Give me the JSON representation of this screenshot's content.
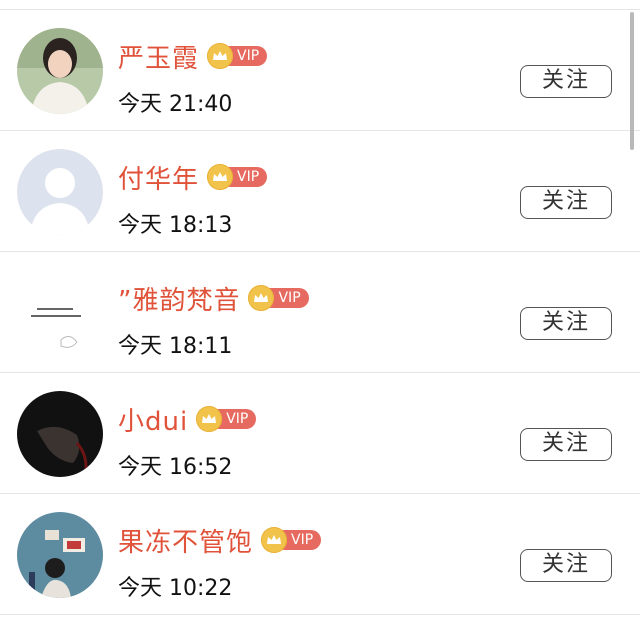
{
  "follow_label": "关注",
  "vip_label": "VIP",
  "users": [
    {
      "name": "严玉霞",
      "time": "今天 21:40"
    },
    {
      "name": "付华年",
      "time": "今天 18:13"
    },
    {
      "name": "”雅韵梵音",
      "time": "今天 18:11"
    },
    {
      "name": "小dui",
      "time": "今天 16:52"
    },
    {
      "name": "果冻不管饱",
      "time": "今天 10:22"
    }
  ],
  "colors": {
    "name": "#e0533a",
    "vip_tag": "#e66a5f",
    "crown": "#f2c34a"
  }
}
